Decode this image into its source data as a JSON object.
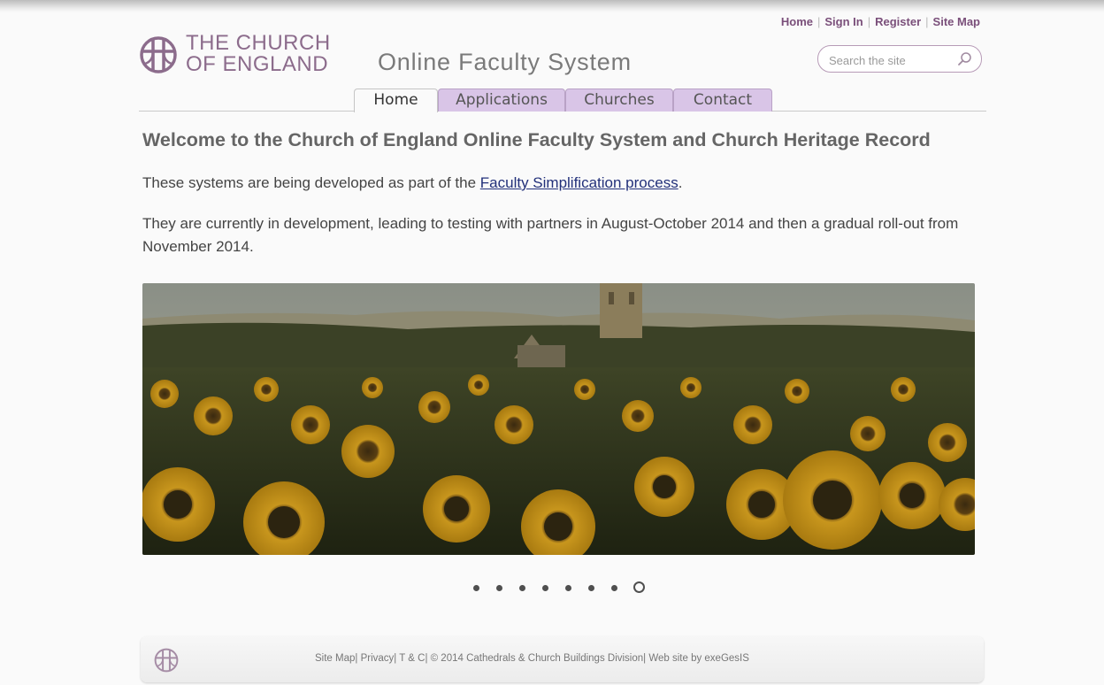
{
  "header": {
    "top_links": [
      "Home",
      "Sign In",
      "Register",
      "Site Map"
    ],
    "logo_line1": "THE CHURCH",
    "logo_line2": "OF ENGLAND",
    "site_title": "Online Faculty System",
    "search_placeholder": "Search the site"
  },
  "nav": {
    "tabs": [
      "Home",
      "Applications",
      "Churches",
      "Contact"
    ],
    "active": "Home"
  },
  "main": {
    "heading": "Welcome to the Church of England Online Faculty System and Church Heritage Record",
    "para1_before": "These systems are being developed as part of the ",
    "para1_link": "Faculty Simplification process",
    "para1_after": ".",
    "para2": "They are currently in development, leading to testing with partners in August-October 2014 and then a gradual roll-out from November 2014."
  },
  "slideshow": {
    "slide_count": 8,
    "active_index": 7
  },
  "footer": {
    "links": [
      "Site Map",
      "Privacy",
      "T & C"
    ],
    "copyright": "© 2014 Cathedrals & Church Buildings Division",
    "credit": "Web site by exeGesIS"
  },
  "colors": {
    "brand_purple": "#8c6c8c",
    "tab_lilac": "#d9c5e7",
    "link_navy": "#22307a"
  }
}
